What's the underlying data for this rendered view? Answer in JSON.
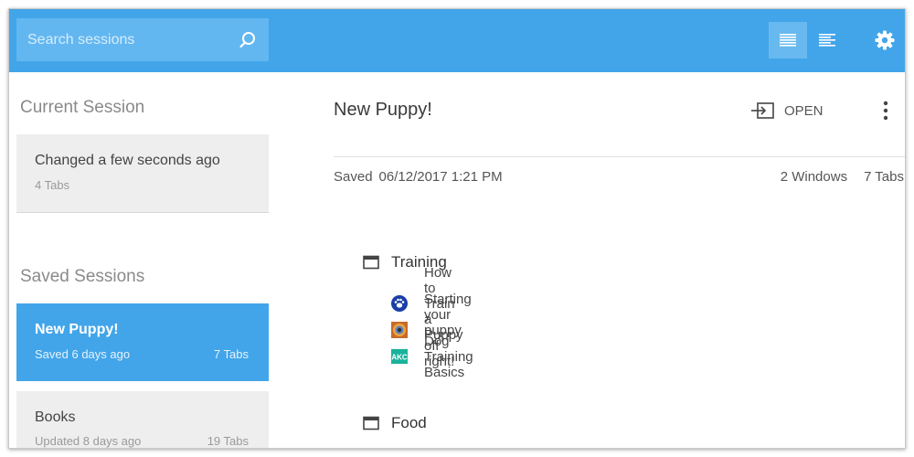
{
  "search": {
    "placeholder": "Search sessions"
  },
  "sidebar": {
    "current_heading": "Current Session",
    "current": {
      "title": "Changed a few seconds ago",
      "sub": "4 Tabs"
    },
    "saved_heading": "Saved Sessions",
    "saved": [
      {
        "title": "New Puppy!",
        "sub": "Saved 6 days ago",
        "tabs": "7 Tabs"
      },
      {
        "title": "Books",
        "sub": "Updated 8 days ago",
        "tabs": "19 Tabs"
      }
    ]
  },
  "main": {
    "title": "New Puppy!",
    "open_label": "OPEN",
    "saved_label": "Saved",
    "saved_date": "06/12/2017 1:21 PM",
    "windows_count": "2 Windows",
    "tabs_count": "7 Tabs",
    "windows": [
      {
        "name": "Training",
        "tabs": [
          {
            "title": "How to Train a Puppy",
            "icon": "paw-favicon"
          },
          {
            "title": "Starting your puppy off right!",
            "icon": "dog-favicon"
          },
          {
            "title": "Dog Training Basics",
            "icon": "akc-favicon",
            "icon_text": "AKC"
          }
        ]
      },
      {
        "name": "Food",
        "tabs": []
      }
    ]
  },
  "colors": {
    "accent": "#42a5e9",
    "card_bg": "#eeeeee"
  }
}
